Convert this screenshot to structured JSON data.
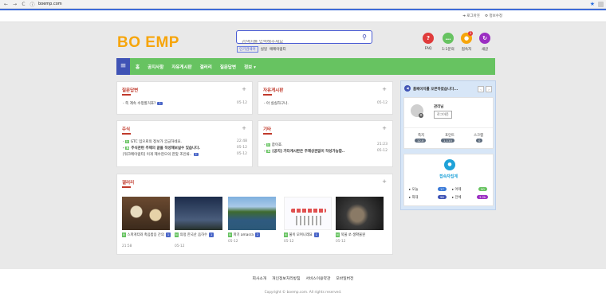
{
  "browser": {
    "url": "boemp.com"
  },
  "toplinks": [
    "로그아웃",
    "정보수정"
  ],
  "logo": "BO EMP",
  "search": {
    "placeholder": "검색어를 입력해주세요",
    "popular_label": "인기검색어",
    "tags": [
      "실일",
      "에메이럼티"
    ]
  },
  "quick": [
    {
      "label": "FAQ",
      "symbol": "?",
      "color": "#e03b3b"
    },
    {
      "label": "1:1문의",
      "symbol": "…",
      "color": "#67c361"
    },
    {
      "label": "접속자",
      "symbol": "●",
      "color": "#f6a50b",
      "badge": "1"
    },
    {
      "label": "새글",
      "symbol": "↻",
      "color": "#9b2ec2"
    }
  ],
  "nav": [
    "홈",
    "공지사항",
    "자유게시판",
    "갤러리",
    "질문답변",
    "정보"
  ],
  "panels": {
    "qna": {
      "title": "질문답변",
      "rows": [
        {
          "text": "- 쪽 계속 수정할거죠?",
          "count": "1",
          "date": "05-12"
        }
      ]
    },
    "free": {
      "title": "자유게시판",
      "rows": [
        {
          "text": "- 아 실실하구나.",
          "date": "05-12"
        }
      ]
    },
    "notice": {
      "title": "주식",
      "rows": [
        {
          "text": "GTC 입으로의 정보가 궁금하네요.",
          "date": "22:48",
          "new": true
        },
        {
          "text": "주식관련 주제의 글을 작성해보실수 있습니다.",
          "date": "05-12",
          "new": true,
          "bold": true
        },
        {
          "text": "[워크메이럼티] 이게 제수현으의 한맞 조인류..",
          "count": "2",
          "date": "05-12"
        }
      ]
    },
    "etc": {
      "title": "기타",
      "rows": [
        {
          "text": "참이죠.",
          "date": "21:23",
          "new": true
        },
        {
          "text": "[공지] 기타게시판은 주제상관없이 작성가능합..",
          "date": "05-12",
          "new": true,
          "bold": true
        }
      ]
    },
    "gallery": {
      "title": "갤러리",
      "items": [
        {
          "caption": "스파게티와 촉음밥응 간의",
          "count": "1",
          "date": "21:58"
        },
        {
          "caption": "의정 한국산 음하수",
          "count": "1",
          "date": "05-12"
        },
        {
          "caption": "파기 amasra",
          "count": "2",
          "date": "05-12"
        },
        {
          "caption": "불이 모여니레요",
          "count": "1",
          "date": "05-12"
        },
        {
          "caption": "북울 쏘 생확물원",
          "date": "05-12"
        }
      ]
    }
  },
  "sidebar": {
    "notice": "홈페이지를 오픈하였습니다...",
    "nickname": "관리님",
    "logout": "로그아웃",
    "stats": [
      {
        "label": "쪽지",
        "value": "12.0"
      },
      {
        "label": "포인트",
        "value": "1,110"
      },
      {
        "label": "스크랩",
        "value": "0"
      }
    ],
    "visitor_title": "접속자집계",
    "visitors": [
      {
        "label": "오늘",
        "value": "17"
      },
      {
        "label": "어제",
        "value": "90"
      },
      {
        "label": "최대",
        "value": "98"
      },
      {
        "label": "전체",
        "value": "3.2k"
      }
    ]
  },
  "footer": {
    "links": [
      "회사소개",
      "개인정보처리방침",
      "서비스이용약관",
      "모바일버전"
    ],
    "copyright": "Copyright © boemp.com. All rights reserved."
  }
}
